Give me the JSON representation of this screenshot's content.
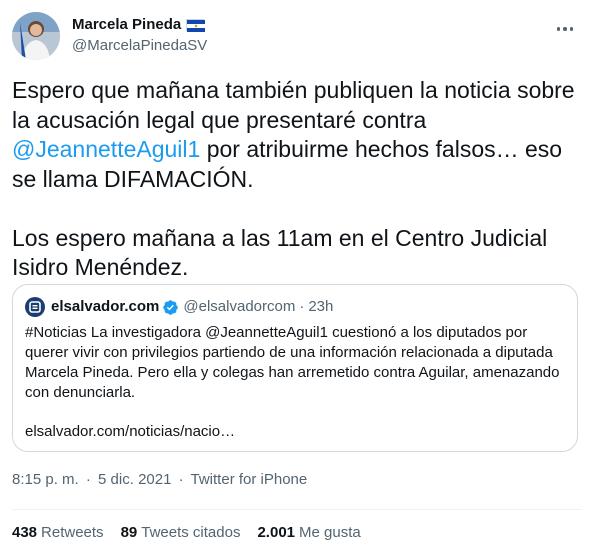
{
  "author": {
    "display_name": "Marcela Pineda",
    "handle": "@MarcelaPinedaSV",
    "flag_icon": "el-salvador-flag-icon"
  },
  "tweet": {
    "line1_before": "Espero que mañana también publiquen la noticia sobre la acusación legal que presentaré contra ",
    "mention": "@JeannetteAguil1",
    "line1_after": " por atribuirme hechos falsos… eso se llama DIFAMACIÓN.",
    "paragraph2": "Los espero mañana a las 11am en el Centro Judicial Isidro Menéndez."
  },
  "quoted": {
    "name": "elsalvador.com",
    "handle": "@elsalvadorcom",
    "separator": "·",
    "time": "23h",
    "text": "#Noticias La investigadora @JeannetteAguil1 cuestionó a los diputados por querer vivir con privilegios partiendo de una información relacionada a diputada Marcela Pineda. Pero ella y colegas han arremetido contra Aguilar, amenazando con denunciarla.",
    "link": "elsalvador.com/noticias/nacio…"
  },
  "meta": {
    "time": "8:15 p. m.",
    "date": "5 dic. 2021",
    "source": "Twitter for iPhone",
    "sep": "·"
  },
  "stats": {
    "retweets_count": "438",
    "retweets_label": "Retweets",
    "quotes_count": "89",
    "quotes_label": "Tweets citados",
    "likes_count": "2.001",
    "likes_label": "Me gusta"
  },
  "colors": {
    "link": "#1d9bf0",
    "muted": "#536471",
    "text": "#0f1419",
    "border": "#cfd9de"
  }
}
